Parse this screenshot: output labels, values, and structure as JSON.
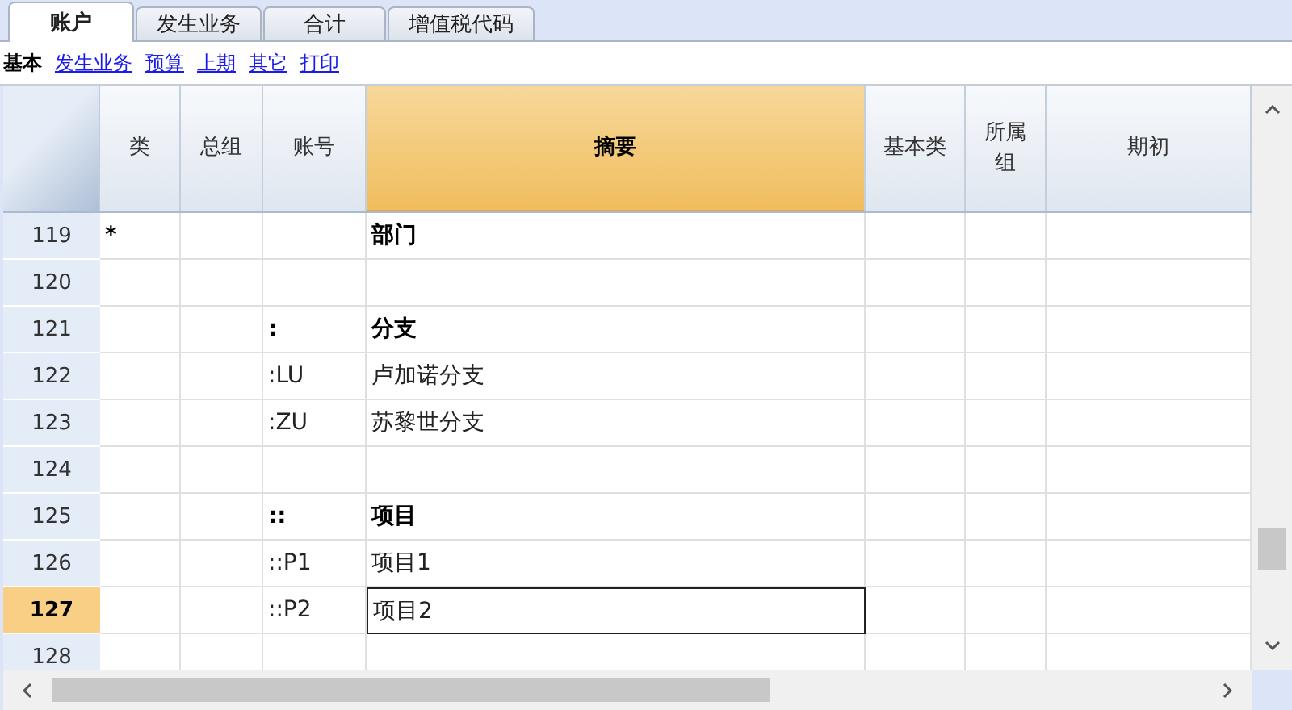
{
  "tabs": [
    {
      "label": "账户",
      "selected": true
    },
    {
      "label": "发生业务",
      "selected": false
    },
    {
      "label": "合计",
      "selected": false
    },
    {
      "label": "增值税代码",
      "selected": false
    }
  ],
  "views": [
    {
      "label": "基本",
      "selected": true
    },
    {
      "label": "发生业务",
      "selected": false
    },
    {
      "label": "预算",
      "selected": false
    },
    {
      "label": "上期",
      "selected": false
    },
    {
      "label": "其它",
      "selected": false
    },
    {
      "label": "打印",
      "selected": false
    }
  ],
  "columns": [
    {
      "label": "类",
      "selected": false
    },
    {
      "label": "总组",
      "selected": false
    },
    {
      "label": "账号",
      "selected": false
    },
    {
      "label": "摘要",
      "selected": true
    },
    {
      "label": "基本类",
      "selected": false
    },
    {
      "label": "所属组",
      "selected": false
    },
    {
      "label": "期初",
      "selected": false
    }
  ],
  "rows": [
    {
      "number": "119",
      "selected": false,
      "bold": true,
      "type": "*",
      "description": "部门"
    },
    {
      "number": "120",
      "selected": false
    },
    {
      "number": "121",
      "selected": false,
      "bold": true,
      "account": ":",
      "description": "分支"
    },
    {
      "number": "122",
      "selected": false,
      "bold": false,
      "account": ":LU",
      "description": "卢加诺分支"
    },
    {
      "number": "123",
      "selected": false,
      "bold": false,
      "account": ":ZU",
      "description": "苏黎世分支"
    },
    {
      "number": "124",
      "selected": false
    },
    {
      "number": "125",
      "selected": false,
      "bold": true,
      "account": "::",
      "description": "项目"
    },
    {
      "number": "126",
      "selected": false,
      "bold": false,
      "account": "::P1",
      "description": "项目1"
    },
    {
      "number": "127",
      "selected": true,
      "bold": false,
      "account": "::P2",
      "description": "项目2"
    },
    {
      "number": "128",
      "selected": false
    }
  ]
}
